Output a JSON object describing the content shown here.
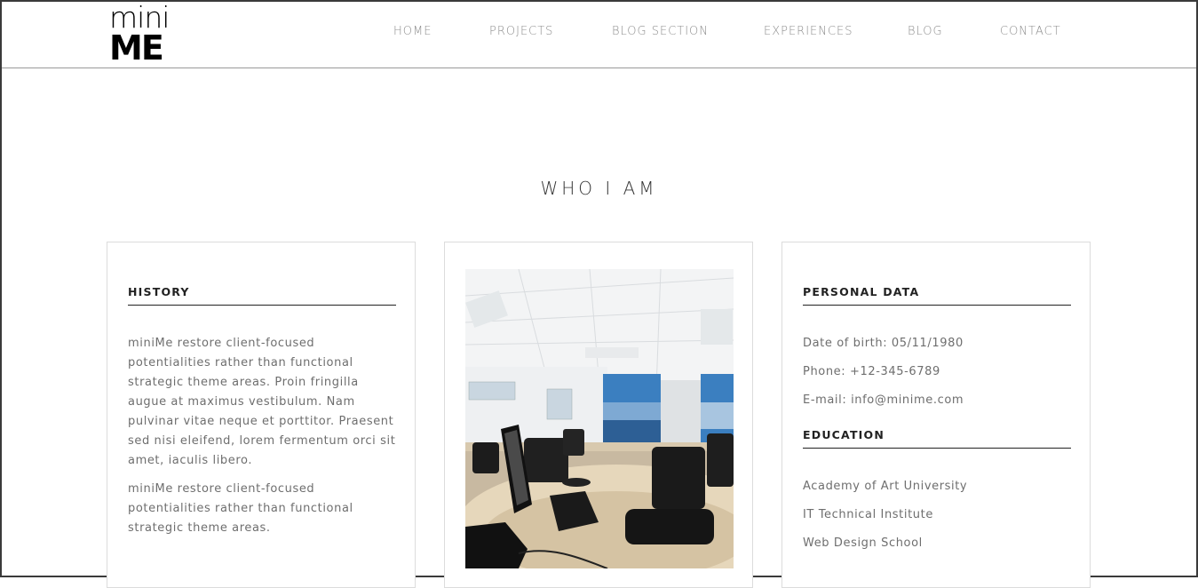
{
  "logo": {
    "line1": "mini",
    "line2": "ME"
  },
  "nav": {
    "items": [
      {
        "label": "HOME"
      },
      {
        "label": "PROJECTS"
      },
      {
        "label": "BLOG SECTION"
      },
      {
        "label": "EXPERIENCES"
      },
      {
        "label": "BLOG"
      },
      {
        "label": "CONTACT"
      }
    ]
  },
  "section": {
    "title": "WHO I AM"
  },
  "history": {
    "heading": "HISTORY",
    "paragraph1": "miniMe restore client-focused potentialities rather than functional strategic theme areas. Proin fringilla augue at maximus vestibulum. Nam pulvinar vitae neque et porttitor. Praesent sed nisi eleifend, lorem fermentum orci sit amet, iaculis libero.",
    "paragraph2": "miniMe restore client-focused potentialities rather than functional strategic theme areas."
  },
  "photo": {
    "alt": "Office interior with desks, chairs and computer"
  },
  "personal": {
    "heading": "PERSONAL DATA",
    "items": [
      {
        "text": "Date of birth: 05/11/1980"
      },
      {
        "text": "Phone: +12-345-6789"
      },
      {
        "text": "E-mail: info@minime.com"
      }
    ]
  },
  "education": {
    "heading": "EDUCATION",
    "items": [
      {
        "text": "Academy of Art University"
      },
      {
        "text": "IT Technical Institute"
      },
      {
        "text": "Web Design School"
      }
    ]
  }
}
